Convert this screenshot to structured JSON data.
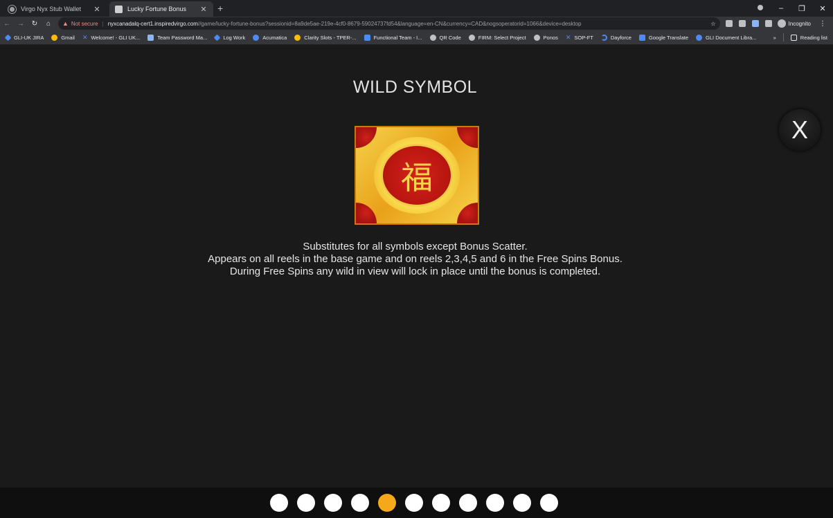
{
  "browser": {
    "tabs": [
      {
        "title": "Virgo Nyx Stub Wallet",
        "icon": "globe-icon",
        "active": false
      },
      {
        "title": "Lucky Fortune Bonus",
        "icon": "game-favicon-icon",
        "active": true
      }
    ],
    "new_tab": "+",
    "window_controls": {
      "minimize": "–",
      "maximize": "❐",
      "close": "✕"
    },
    "address": {
      "warning": "▲",
      "not_secure": "Not secure",
      "host": "nyxcanadalq-cert1.inspiredvirgo.com",
      "path": "//game/lucky-fortune-bonus?sessionid=8a9de5ae-219e-4cf0-8679-59024737fd54&language=en-CN&currency=CAD&nogsoperatorid=1066&device=desktop"
    },
    "profile_label": "Incognito",
    "reading_list": "Reading list",
    "bookmarks": [
      {
        "label": "GLI-UK JIRA",
        "icon": "jira-icon"
      },
      {
        "label": "Gmail",
        "icon": "google-icon"
      },
      {
        "label": "Welcome! - GLI UK...",
        "icon": "confluence-icon"
      },
      {
        "label": "Team Password Ma...",
        "icon": "calendar-icon"
      },
      {
        "label": "Log Work",
        "icon": "jira-icon"
      },
      {
        "label": "Acumatica",
        "icon": "acumatica-icon"
      },
      {
        "label": "Clarity Slots - TPER-...",
        "icon": "google-icon"
      },
      {
        "label": "Functional Team - I...",
        "icon": "docs-icon"
      },
      {
        "label": "QR Code",
        "icon": "globe-icon"
      },
      {
        "label": "FIRM: Select Project",
        "icon": "globe-icon"
      },
      {
        "label": "Ponos",
        "icon": "globe-icon"
      },
      {
        "label": "SOP-FT",
        "icon": "confluence-icon"
      },
      {
        "label": "Dayforce",
        "icon": "dayforce-icon"
      },
      {
        "label": "Google Translate",
        "icon": "translate-icon"
      },
      {
        "label": "GLI Document Libra...",
        "icon": "library-icon"
      }
    ]
  },
  "game": {
    "title": "WILD SYMBOL",
    "symbol_glyph": "福",
    "description": [
      "Substitutes for all symbols except Bonus Scatter.",
      "Appears on all reels in the base game and on reels 2,3,4,5 and 6 in the Free Spins Bonus.",
      "During Free Spins any wild in view will lock in place until the bonus is completed."
    ],
    "close_label": "X",
    "pager": {
      "total": 11,
      "current": 5,
      "active_color": "#f6a81b",
      "inactive_color": "#ffffff"
    }
  }
}
